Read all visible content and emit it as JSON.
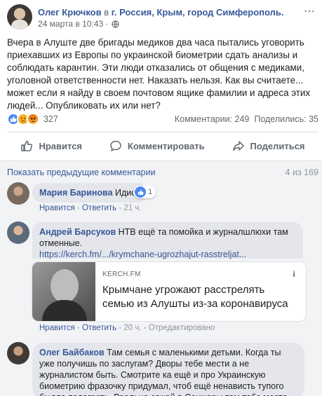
{
  "post": {
    "author": "Олег Крючков",
    "location_prefix": "в",
    "location": "г. Россия, Крым, город Симферополь.",
    "timestamp": "24 марта в 10:43 ·",
    "text": "Вчера в Алуште две бригады медиков два часа пытались уговорить приехавших из Европы по украинской биометрии сдать анализы и соблюдать карантин. Эти люди отказались от общения с медиками, уголовной ответственности нет. Наказать нельзя. Как вы считаете... может если я найду в своем почтовом ящике фамилии и адреса этих людей... Опубликовать их или нет?",
    "reaction_count": "327",
    "comments_count": "Комментарии: 249",
    "shares_count": "Поделились: 35",
    "more_icon": "⋯"
  },
  "actions": {
    "like": "Нравится",
    "comment": "Комментировать",
    "share": "Поделиться"
  },
  "comments_section": {
    "prev_link": "Показать предыдущие комментарии",
    "counter": "4 из 169"
  },
  "comments": [
    {
      "author": "Мария Баринова",
      "text": "Идиот",
      "like": "Нравится",
      "reply": "Ответить",
      "time": "21 ч.",
      "reaction_count": "1"
    },
    {
      "author": "Андрей Барсуков",
      "text": "НТВ ещё та помойка и журналшлюхи там отменные.",
      "link": "https://kerch.fm/.../krymchane-ugrozhajut-rasstreljat...",
      "preview_domain": "KERCH.FM",
      "preview_title": "Крымчане угрожают расстрелять семью из Алушты из-за коронавируса",
      "like": "Нравится",
      "reply": "Ответить",
      "time": "20 ч.",
      "edited": "Отредактировано"
    },
    {
      "author": "Олег Байбаков",
      "text": "Там семья с маленькими детьми. Когда ты уже получишь по заслугам? Дворы тебе мести а не журналистом быть. Смотрите ка ещё и про Украинскую биометрию фразочку придумал, чтоб ещё ненависть тупого быдла подогреть. Реально езжай в Санжары там тебе место."
    }
  ],
  "colors": {
    "link_blue": "#385898",
    "bubble_bg": "#e4e6eb",
    "comments_bg": "#f2f3f5",
    "like_blue": "#4a89f3"
  }
}
